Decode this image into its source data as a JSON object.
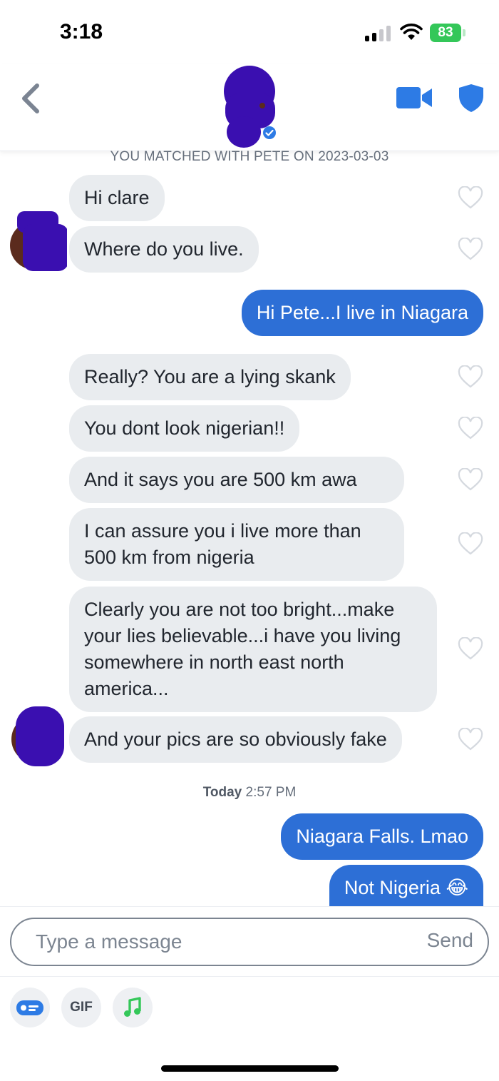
{
  "status_bar": {
    "time": "3:18",
    "battery": "83"
  },
  "header": {
    "back_icon": "chevron-left-icon",
    "video_icon": "video-camera-icon",
    "safety_icon": "shield-icon"
  },
  "match_note": "YOU MATCHED WITH PETE ON 2023-03-03",
  "messages": [
    {
      "from": "them",
      "text": "Hi clare"
    },
    {
      "from": "them",
      "text": "Where do you live."
    },
    {
      "from": "me",
      "text": "Hi Pete...I live in Niagara"
    },
    {
      "from": "them",
      "text": "Really? You are a lying skank"
    },
    {
      "from": "them",
      "text": "You dont look nigerian!!"
    },
    {
      "from": "them",
      "text": "And it says you are 500 km awa"
    },
    {
      "from": "them",
      "text": "I can assure you i live more than 500 km from nigeria"
    },
    {
      "from": "them",
      "text": "Clearly you are not too bright...make your lies believable...i have you living somewhere in north east north america..."
    },
    {
      "from": "them",
      "text": "And your pics are so obviously fake"
    },
    {
      "from": "me",
      "text": "Niagara Falls. Lmao"
    },
    {
      "from": "me",
      "text": "Not Nigeria 😂"
    }
  ],
  "day_separator": {
    "day": "Today",
    "time": "2:57 PM"
  },
  "composer": {
    "placeholder": "Type a message",
    "send_label": "Send",
    "gif_label": "GIF"
  },
  "colors": {
    "outgoing": "#2d6fd6",
    "incoming": "#e9ecef",
    "accent_blue": "#2d7be5",
    "battery_green": "#34c759",
    "redaction": "#3a0fb0"
  }
}
